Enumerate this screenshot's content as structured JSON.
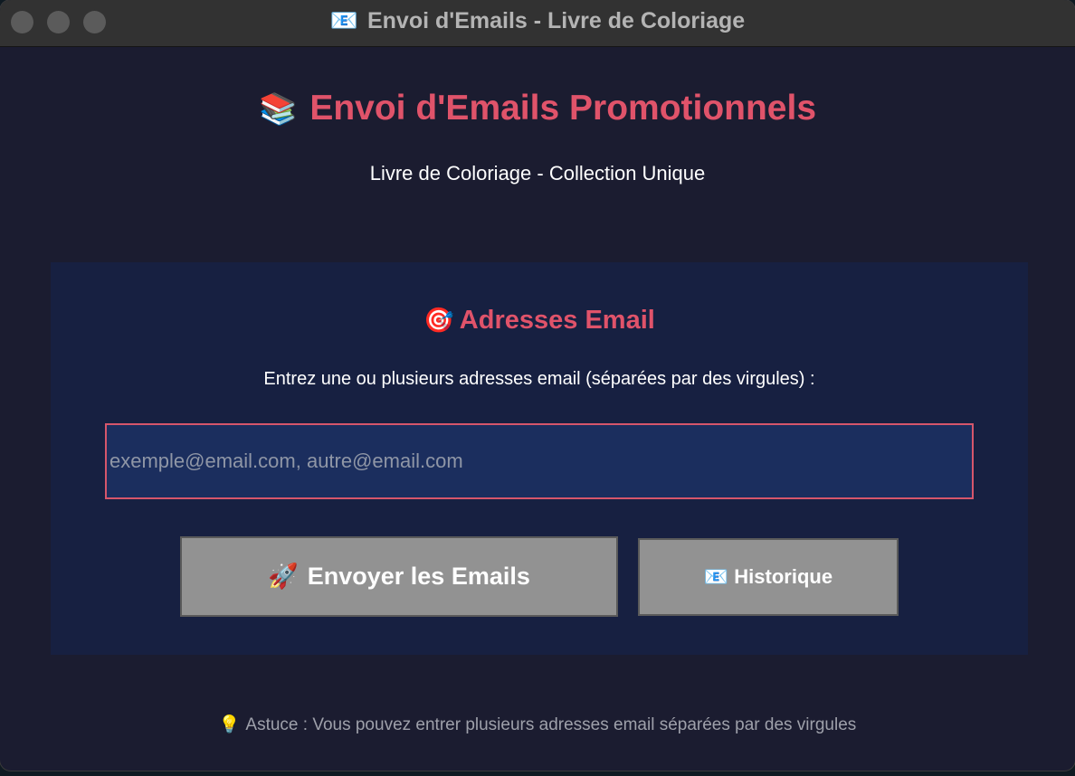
{
  "window": {
    "title": "Envoi d'Emails - Livre de Coloriage",
    "title_icon": "📧"
  },
  "header": {
    "title": "Envoi d'Emails Promotionnels",
    "title_icon": "📚",
    "subtitle": "Livre de Coloriage - Collection Unique"
  },
  "panel": {
    "title": "Adresses Email",
    "title_icon": "🎯",
    "instructions": "Entrez une ou plusieurs adresses email (séparées par des virgules) :",
    "email_input": {
      "value": "",
      "placeholder": "exemple@email.com, autre@email.com"
    },
    "send_button": {
      "label": "Envoyer les Emails",
      "icon": "🚀"
    },
    "history_button": {
      "label": "Historique",
      "icon": "📧"
    }
  },
  "footer": {
    "tip": "Astuce : Vous pouvez entrer plusieurs adresses email séparées par des virgules",
    "tip_icon": "💡"
  },
  "colors": {
    "accent": "#e0536a",
    "window_background": "#1b1c30",
    "panel_background": "#172041",
    "input_background": "#1b2e5e",
    "button_background": "#929292",
    "titlebar": "#323232"
  }
}
